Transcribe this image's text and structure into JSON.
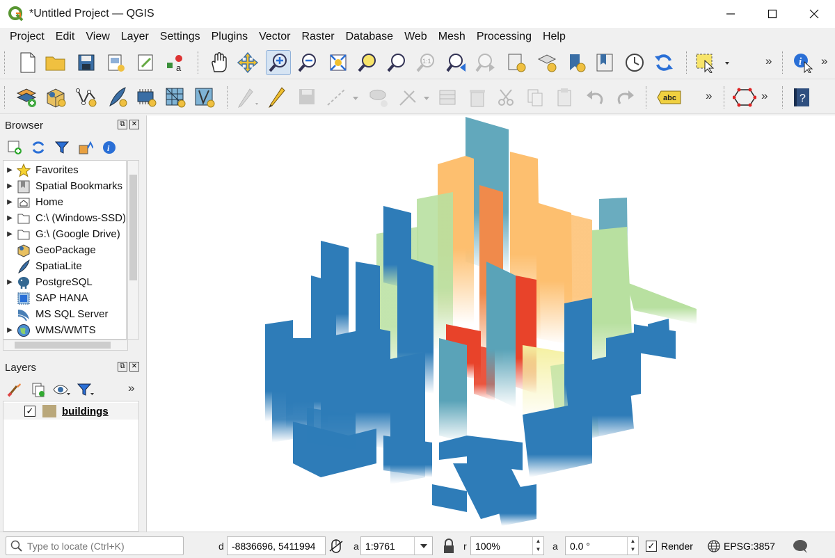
{
  "window": {
    "title": "*Untitled Project — QGIS"
  },
  "menu": [
    "Project",
    "Edit",
    "View",
    "Layer",
    "Settings",
    "Plugins",
    "Vector",
    "Raster",
    "Database",
    "Web",
    "Mesh",
    "Processing",
    "Help"
  ],
  "browser": {
    "title": "Browser",
    "items": [
      {
        "label": "Favorites",
        "icon": "star-icon",
        "expandable": true
      },
      {
        "label": "Spatial Bookmarks",
        "icon": "bookmark-icon",
        "expandable": true
      },
      {
        "label": "Home",
        "icon": "home-folder-icon",
        "expandable": true
      },
      {
        "label": "C:\\ (Windows-SSD)",
        "icon": "drive-folder-icon",
        "expandable": true
      },
      {
        "label": "G:\\ (Google Drive)",
        "icon": "drive-folder-icon",
        "expandable": true
      },
      {
        "label": "GeoPackage",
        "icon": "geopackage-icon",
        "expandable": false
      },
      {
        "label": "SpatiaLite",
        "icon": "feather-icon",
        "expandable": false
      },
      {
        "label": "PostgreSQL",
        "icon": "elephant-icon",
        "expandable": true
      },
      {
        "label": "SAP HANA",
        "icon": "hana-icon",
        "expandable": false
      },
      {
        "label": "MS SQL Server",
        "icon": "mssql-icon",
        "expandable": false
      },
      {
        "label": "WMS/WMTS",
        "icon": "globe-icon",
        "expandable": true
      }
    ]
  },
  "layers": {
    "title": "Layers",
    "items": [
      {
        "name": "buildings",
        "checked": true,
        "color": "#b9a77a"
      }
    ]
  },
  "statusbar": {
    "locate_placeholder": "Type to locate (Ctrl+K)",
    "coord_label": "d",
    "coordinate": "-8836696, 5411994",
    "scale_label": "a",
    "scale": "1:9761",
    "magnifier_label": "r",
    "magnifier": "100%",
    "rotation_label": "a",
    "rotation": "0.0 °",
    "render_label": "Render",
    "render_checked": true,
    "crs": "EPSG:3857"
  },
  "colors": {
    "low": "#2e7cb8",
    "mid_low": "#5aa3b8",
    "mid": "#b8e0a0",
    "mid_high": "#fdbf6f",
    "high": "#e8432a",
    "layer_swatch": "#b9a77a"
  }
}
